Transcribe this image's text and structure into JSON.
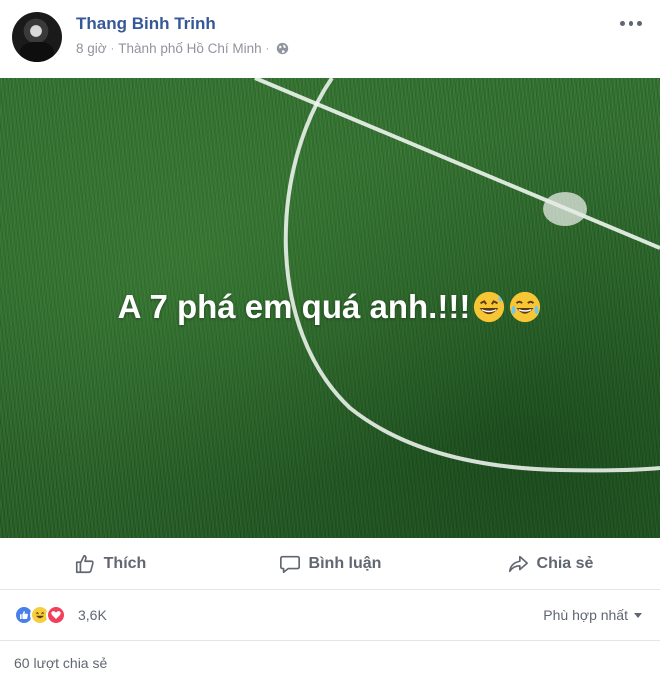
{
  "header": {
    "author_name": "Thang Binh Trinh",
    "time": "8 giờ",
    "separator": "·",
    "location": "Thành phố Hồ Chí Minh",
    "icons": {
      "privacy": "globe-icon",
      "more": "more-options-icon"
    }
  },
  "post": {
    "text": "A 7 phá em quá anh.!!!",
    "emoji": [
      "grinning-sweat-icon",
      "tears-of-joy-icon"
    ],
    "background": "soccer-field-grass",
    "text_color": "#ffffff"
  },
  "actions": {
    "like_label": "Thích",
    "comment_label": "Bình luận",
    "share_label": "Chia sẻ"
  },
  "reactions": {
    "types": [
      "like",
      "haha",
      "love"
    ],
    "count": "3,6K",
    "sort_label": "Phù hợp nhất"
  },
  "shares": {
    "label": "60 lượt chia sẻ"
  },
  "colors": {
    "author": "#365899",
    "secondary_text": "#606770",
    "meta_text": "#90949c",
    "like_blue": "#4a7fe8",
    "love_red": "#f0405b",
    "haha_yellow": "#f8cd3c"
  }
}
